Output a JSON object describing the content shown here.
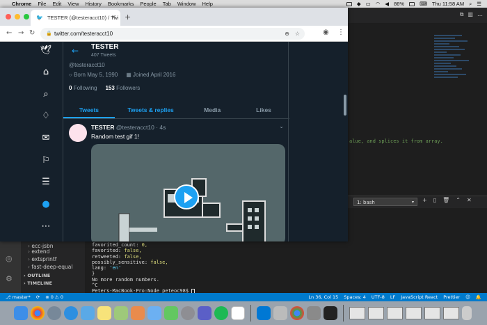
{
  "menubar": {
    "app": "Chrome",
    "items": [
      "File",
      "Edit",
      "View",
      "History",
      "Bookmarks",
      "People",
      "Tab",
      "Window",
      "Help"
    ],
    "battery": "86%",
    "clock": "Thu 11:58 AM"
  },
  "browser": {
    "tab_title": "TESTER (@testeracct10) / Twi",
    "url": "twitter.com/testeracct10"
  },
  "twitter": {
    "profile_name": "TESTER",
    "tweet_count": "407 Tweets",
    "handle": "@testeracct10",
    "born": "Born May 5, 1990",
    "joined": "Joined April 2016",
    "following_count": "0",
    "following_label": "Following",
    "followers_count": "153",
    "followers_label": "Followers",
    "tabs": [
      "Tweets",
      "Tweets & replies",
      "Media",
      "Likes"
    ],
    "tweet": {
      "name": "TESTER",
      "handle": "@testeracct10",
      "time": "4s",
      "text": "Random test gif 1!"
    }
  },
  "vscode": {
    "editor_line": "alue, and splices it from array.",
    "terminal_select": "1: bash",
    "sidebar": [
      {
        "label": "ecc-jsbn",
        "indent": 2
      },
      {
        "label": "extend",
        "indent": 2
      },
      {
        "label": "extsprintf",
        "indent": 2
      },
      {
        "label": "fast-deep-equal",
        "indent": 2
      }
    ],
    "outline_label": "OUTLINE",
    "timeline_label": "TIMELINE",
    "terminal_lines": [
      {
        "key": "favorited_count:",
        "value": "0,"
      },
      {
        "key": "favorited:",
        "value": "false,"
      },
      {
        "key": "retweeted:",
        "value": "false,"
      },
      {
        "key": "possibly_sensitive:",
        "value": "false,"
      },
      {
        "key": "lang:",
        "value": "'en'"
      },
      {
        "key": "}",
        "value": ""
      },
      {
        "key": "No more random numbers.",
        "value": ""
      },
      {
        "key": "^C",
        "value": ""
      },
      {
        "key": "Peters-MacBook-Pro:Node peteoc98$",
        "value": ""
      }
    ],
    "status": {
      "branch": "master*",
      "errors": "0",
      "warnings": "0",
      "position": "Ln 36, Col 15",
      "spaces": "Spaces: 4",
      "encoding": "UTF-8",
      "eol": "LF",
      "language": "JavaScript React",
      "formatter": "Prettier"
    }
  },
  "dock": {
    "apps": [
      "finder-icon",
      "chrome-icon",
      "rocket-icon",
      "safari-icon",
      "mail-icon",
      "notes-icon",
      "preview-icon",
      "photos-icon",
      "finder2-icon",
      "messages-icon",
      "settings-icon",
      "teams-icon",
      "spotify-icon",
      "slack-icon",
      "vscode-icon",
      "xcode-icon",
      "chrome2-icon",
      "system-icon",
      "terminal-icon"
    ]
  }
}
